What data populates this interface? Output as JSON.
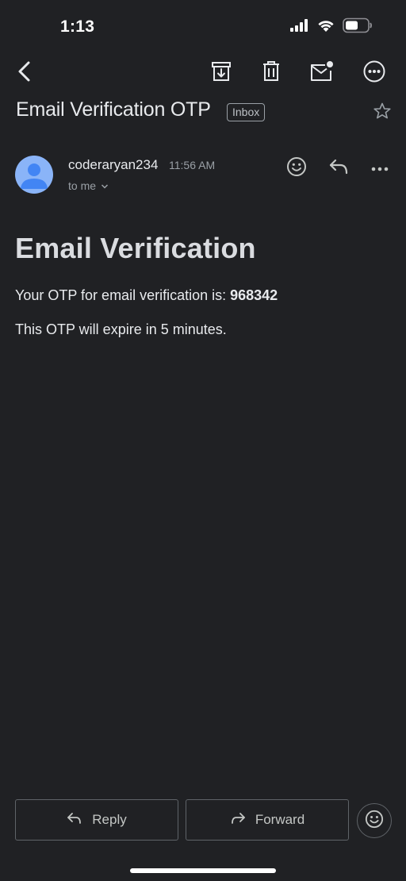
{
  "status_bar": {
    "time": "1:13",
    "icons": [
      "cellular-signal-icon",
      "wifi-icon",
      "battery-icon"
    ]
  },
  "toolbar": {
    "back_icon": "back-arrow-icon",
    "actions": [
      "archive-icon",
      "trash-icon",
      "mark-unread-icon",
      "more-icon"
    ]
  },
  "email": {
    "subject": "Email Verification OTP",
    "label": "Inbox",
    "sender": "coderaryan234",
    "time": "11:56 AM",
    "recipient": "to me",
    "heading": "Email Verification",
    "otp_prefix": "Your OTP for email verification is: ",
    "otp_code": "968342",
    "expiry_text": "This OTP will expire in 5 minutes."
  },
  "bottom_actions": {
    "reply_label": "Reply",
    "forward_label": "Forward"
  },
  "colors": {
    "background": "#202124",
    "avatar": "#8ab4f8",
    "text": "#e8eaed",
    "muted": "#9aa0a6",
    "border": "#5f6368"
  }
}
